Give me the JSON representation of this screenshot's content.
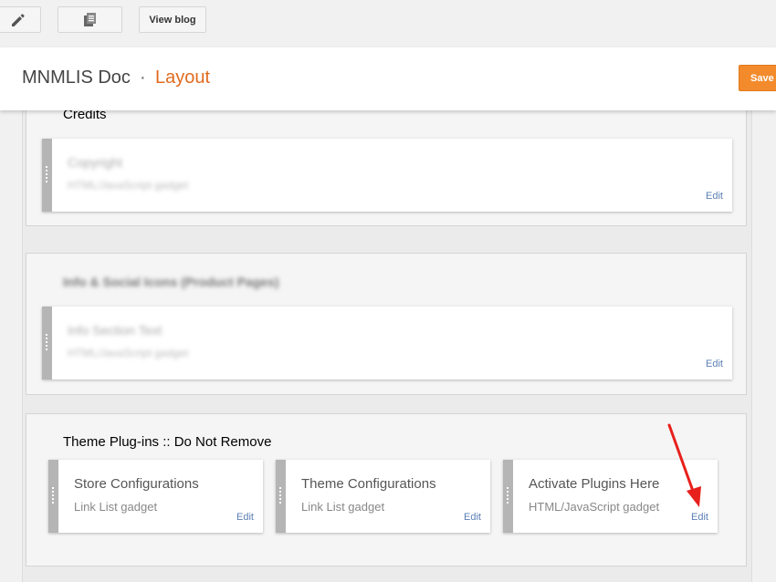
{
  "toolbar": {
    "edit_icon": "pencil-icon",
    "pages_icon": "pages-icon",
    "view_blog_label": "View blog"
  },
  "header": {
    "blog_name": "MNMLIS Doc",
    "separator": "·",
    "page_name": "Layout",
    "save_label": "Save a"
  },
  "sections": [
    {
      "title": "Credits",
      "gadgets": [
        {
          "title": "Copyright",
          "type": "HTML/JavaScript gadget",
          "edit": "Edit"
        }
      ]
    },
    {
      "title": "Info & Social Icons (Product Pages)",
      "gadgets": [
        {
          "title": "Info Section Text",
          "type": "HTML/JavaScript gadget",
          "edit": "Edit"
        }
      ]
    },
    {
      "title": "Theme Plug-ins :: Do Not Remove",
      "gadgets": [
        {
          "title": "Store Configurations",
          "type": "Link List gadget",
          "edit": "Edit"
        },
        {
          "title": "Theme Configurations",
          "type": "Link List gadget",
          "edit": "Edit"
        },
        {
          "title": "Activate Plugins Here",
          "type": "HTML/JavaScript gadget",
          "edit": "Edit"
        }
      ]
    }
  ],
  "colors": {
    "accent": "#e06b1f",
    "save_button": "#f38b2c",
    "edit_link": "#5b7fb5",
    "annotation_arrow": "#e8201c"
  }
}
